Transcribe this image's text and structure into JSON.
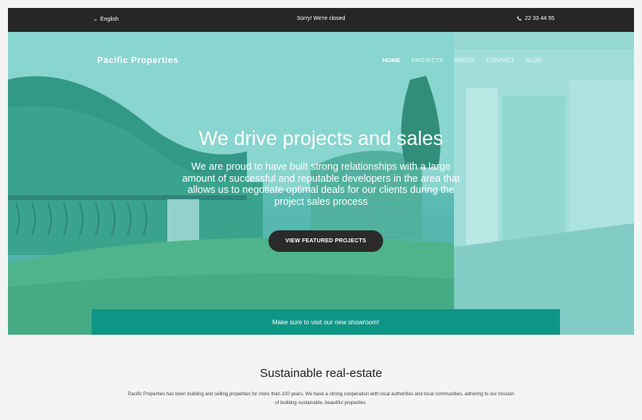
{
  "topbar": {
    "language": "English",
    "status": "Sorry! We're closed",
    "phone": "22 33 44 55"
  },
  "header": {
    "brand": "Pacific Properties",
    "nav": [
      "HOME",
      "PROJECTS",
      "ABOUT",
      "CONTACT",
      "BLOG"
    ],
    "active_nav": "HOME"
  },
  "hero": {
    "headline": "We drive projects and sales",
    "subtext": "We are proud to have built strong relationships with a large amount of successful and reputable developers in the area that allows us to negotiate optimal deals for our clients during the project sales process",
    "cta_label": "VIEW FEATURED PROJECTS"
  },
  "banner": {
    "text": "Make sure to visit our new showroom!"
  },
  "intro": {
    "title": "Sustainable real-estate",
    "text": "Pacific Properties has been building and selling properties for more than 100 years. We have a strong cooperation with local authorities and local communities, adhering to our mission of building sustainable, beautiful properties."
  },
  "colors": {
    "topbar": "#262626",
    "accent": "#0f9585",
    "hero_tint": "#62b9b2",
    "cta": "#2a2a2a"
  }
}
